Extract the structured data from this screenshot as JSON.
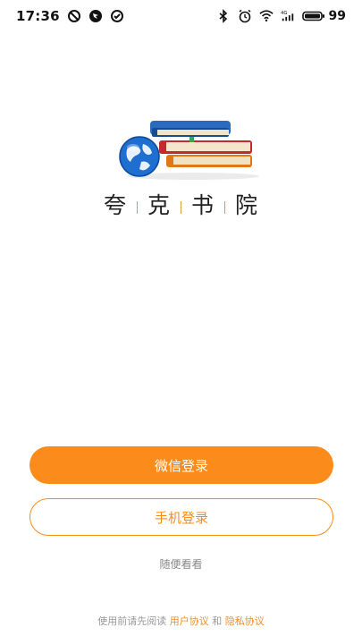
{
  "status_bar": {
    "time": "17:36",
    "battery": "99",
    "left_icons": [
      "do-not-disturb-icon",
      "vpn-icon",
      "check-circle-icon"
    ],
    "right_icons": [
      "bluetooth-icon",
      "alarm-icon",
      "wifi-icon",
      "4g-signal-icon",
      "battery-icon"
    ]
  },
  "app": {
    "name_chars": [
      "夸",
      "克",
      "书",
      "院"
    ],
    "logo": "books-globe-logo"
  },
  "buttons": {
    "wechat_login": "微信登录",
    "phone_login": "手机登录",
    "browse": "随便看看"
  },
  "agreement": {
    "prefix": "使用前请先阅读",
    "user_agreement": "用户协议",
    "and": "和",
    "privacy_policy": "隐私协议"
  },
  "colors": {
    "accent": "#fb8c1b",
    "background": "#ffffff"
  }
}
